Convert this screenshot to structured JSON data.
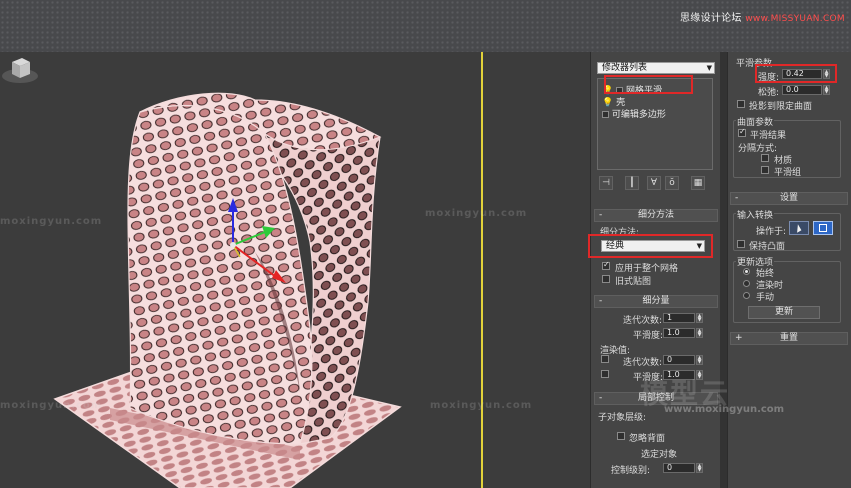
{
  "banner": {
    "brand": "思缘设计论坛",
    "url": "www.MISSYUAN.COM"
  },
  "watermarks": {
    "site": "moxingyun.com",
    "big": "模型云",
    "url": "www.moxingyun.com"
  },
  "modifier_panel": {
    "list_dropdown": "修改器列表",
    "stack": [
      {
        "label": "网格平滑",
        "enabled": true
      },
      {
        "label": "壳",
        "enabled": true
      },
      {
        "label": "可编辑多边形",
        "enabled": false
      }
    ]
  },
  "subdivision_method": {
    "title": "细分方法",
    "method_label": "细分方法:",
    "method_value": "经典",
    "apply_whole_mesh": {
      "label": "应用于整个网格",
      "checked": true
    },
    "old_mapping": {
      "label": "旧式贴图",
      "checked": false
    }
  },
  "subdivision_amount": {
    "title": "细分量",
    "iterations_label": "迭代次数:",
    "iterations_value": "1",
    "smoothness_label": "平滑度:",
    "smoothness_value": "1.0",
    "render_values_label": "渲染值:",
    "render_iterations_label": "迭代次数:",
    "render_iterations_value": "0",
    "render_smoothness_label": "平滑度:",
    "render_smoothness_value": "1.0"
  },
  "local_control": {
    "title": "局部控制",
    "sub_object_label": "子对象层级:",
    "ignore_backfacing_label": "忽略背面",
    "select_object_label": "选定对象",
    "control_level_label": "控制级别:",
    "control_level_value": "0"
  },
  "smoothing_params": {
    "title": "平滑参数",
    "strength_label": "强度:",
    "strength_value": "0.42",
    "relax_label": "松弛:",
    "relax_value": "0.0",
    "project_label": "投影到限定曲面"
  },
  "surface_params": {
    "title": "曲面参数",
    "smooth_result": {
      "label": "平滑结果",
      "checked": true
    },
    "separate_by_label": "分隔方式:",
    "material_label": "材质",
    "smoothing_group_label": "平滑组"
  },
  "settings": {
    "title": "设置",
    "input_conversion_label": "输入转换",
    "operate_on_label": "操作于:",
    "keep_convex_label": "保持凸面",
    "update_options_label": "更新选项",
    "always_label": "始终",
    "when_rendering_label": "渲染时",
    "manual_label": "手动",
    "update_button": "更新"
  },
  "reset": {
    "title": "重置"
  },
  "colors": {
    "accent_red": "#e02828",
    "viewport_frame": "#e2d23a",
    "mesh_fill": "#d99a9c",
    "wire": "#f6dede"
  }
}
